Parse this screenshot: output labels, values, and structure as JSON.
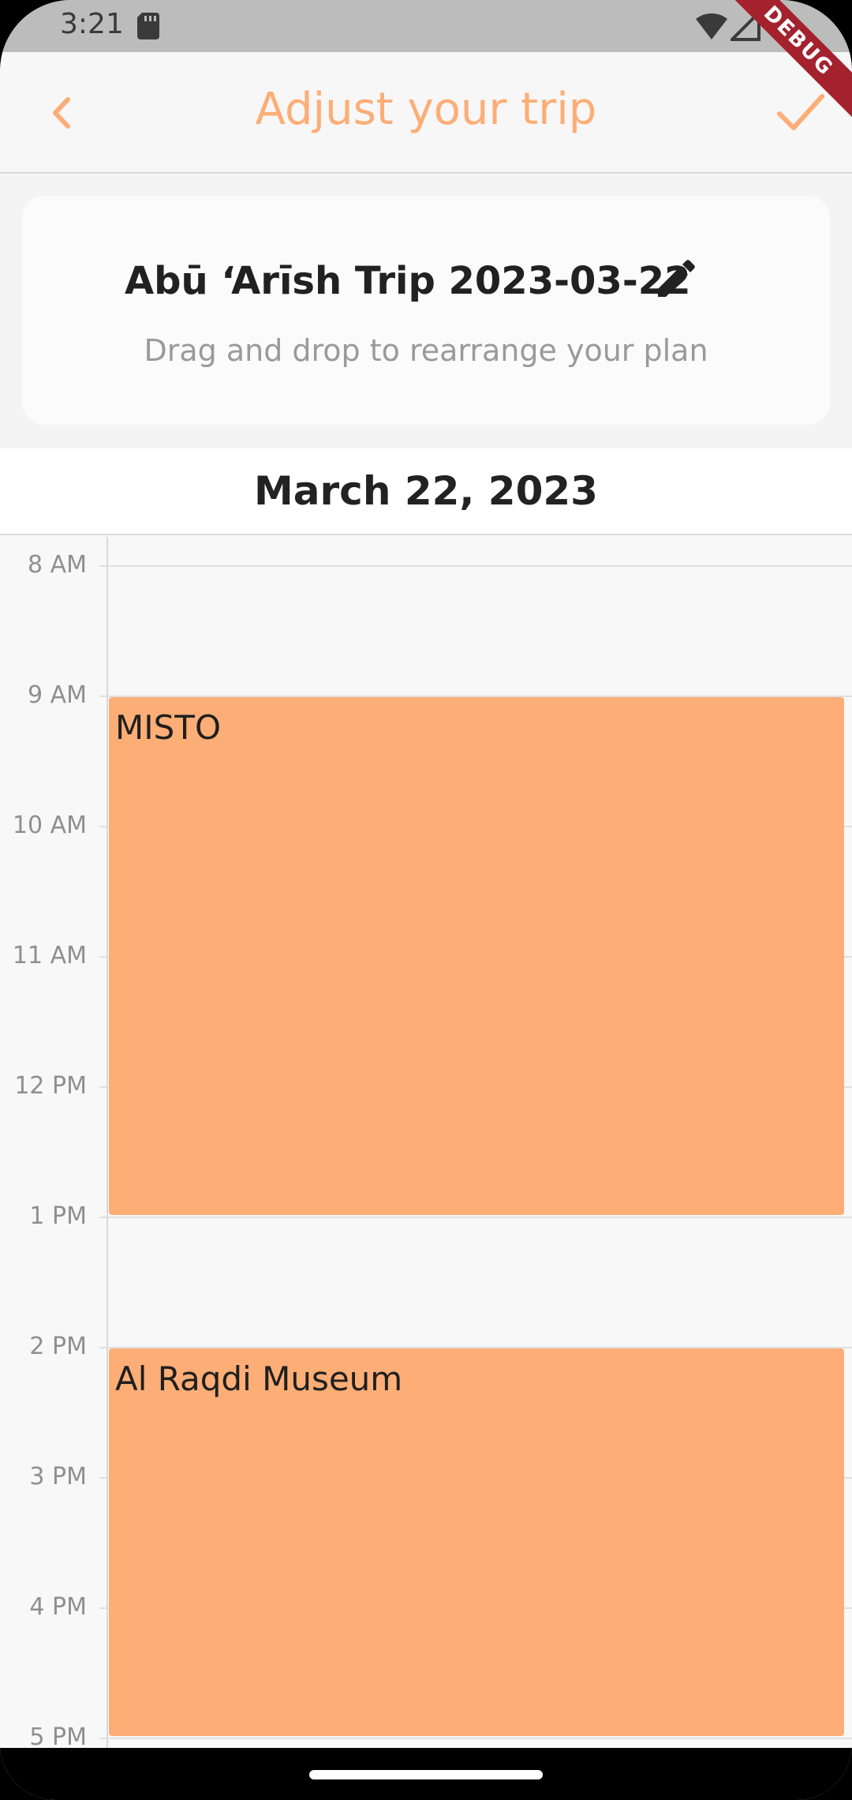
{
  "status_bar": {
    "time": "3:21",
    "icons": [
      "sd-card-icon",
      "wifi-icon",
      "signal-icon"
    ],
    "debug_label": "DEBUG"
  },
  "app_bar": {
    "title": "Adjust your trip",
    "back_icon": "chevron-left-icon",
    "confirm_icon": "check-icon",
    "accent_color": "#fcae76"
  },
  "trip_card": {
    "title": "Abū ‘Arīsh Trip 2023-03-22",
    "edit_icon": "pencil-icon",
    "hint": "Drag and drop to rearrange your plan"
  },
  "calendar": {
    "date": "March 22, 2023",
    "hours": [
      "8 AM",
      "9 AM",
      "10 AM",
      "11 AM",
      "12 PM",
      "1 PM",
      "2 PM",
      "3 PM",
      "4 PM",
      "5 PM"
    ],
    "events": [
      {
        "name": "MISTO",
        "start": "9 AM",
        "end": "1 PM",
        "color": "#fcae76"
      },
      {
        "name": "Al Raqdi Museum",
        "start": "2 PM",
        "end": "5 PM",
        "color": "#fcae76"
      }
    ]
  }
}
